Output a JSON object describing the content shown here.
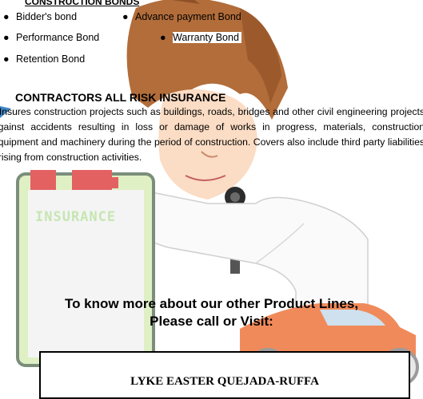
{
  "bonds": {
    "heading": "CONSTRUCTION BONDS",
    "items": [
      "Bidder's bond",
      "Advance payment Bond",
      "Performance Bond",
      "Warranty Bond",
      "Retention Bond"
    ]
  },
  "car_insurance": {
    "heading": "CONTRACTORS ALL RISK INSURANCE",
    "body": "- Insures construction projects such as buildings, roads, bridges and other civil engineering projects against accidents resulting in loss or damage of works in progress, materials, construction equipment and machinery during the period of construction. Covers also include third party liabilities arising from construction activities."
  },
  "clipboard_label": "INSURANCE",
  "contact": {
    "line1": "To know more about our other Product Lines,",
    "line2": "Please call or Visit:",
    "name": "LYKE EASTER QUEJADA-RUFFA"
  }
}
